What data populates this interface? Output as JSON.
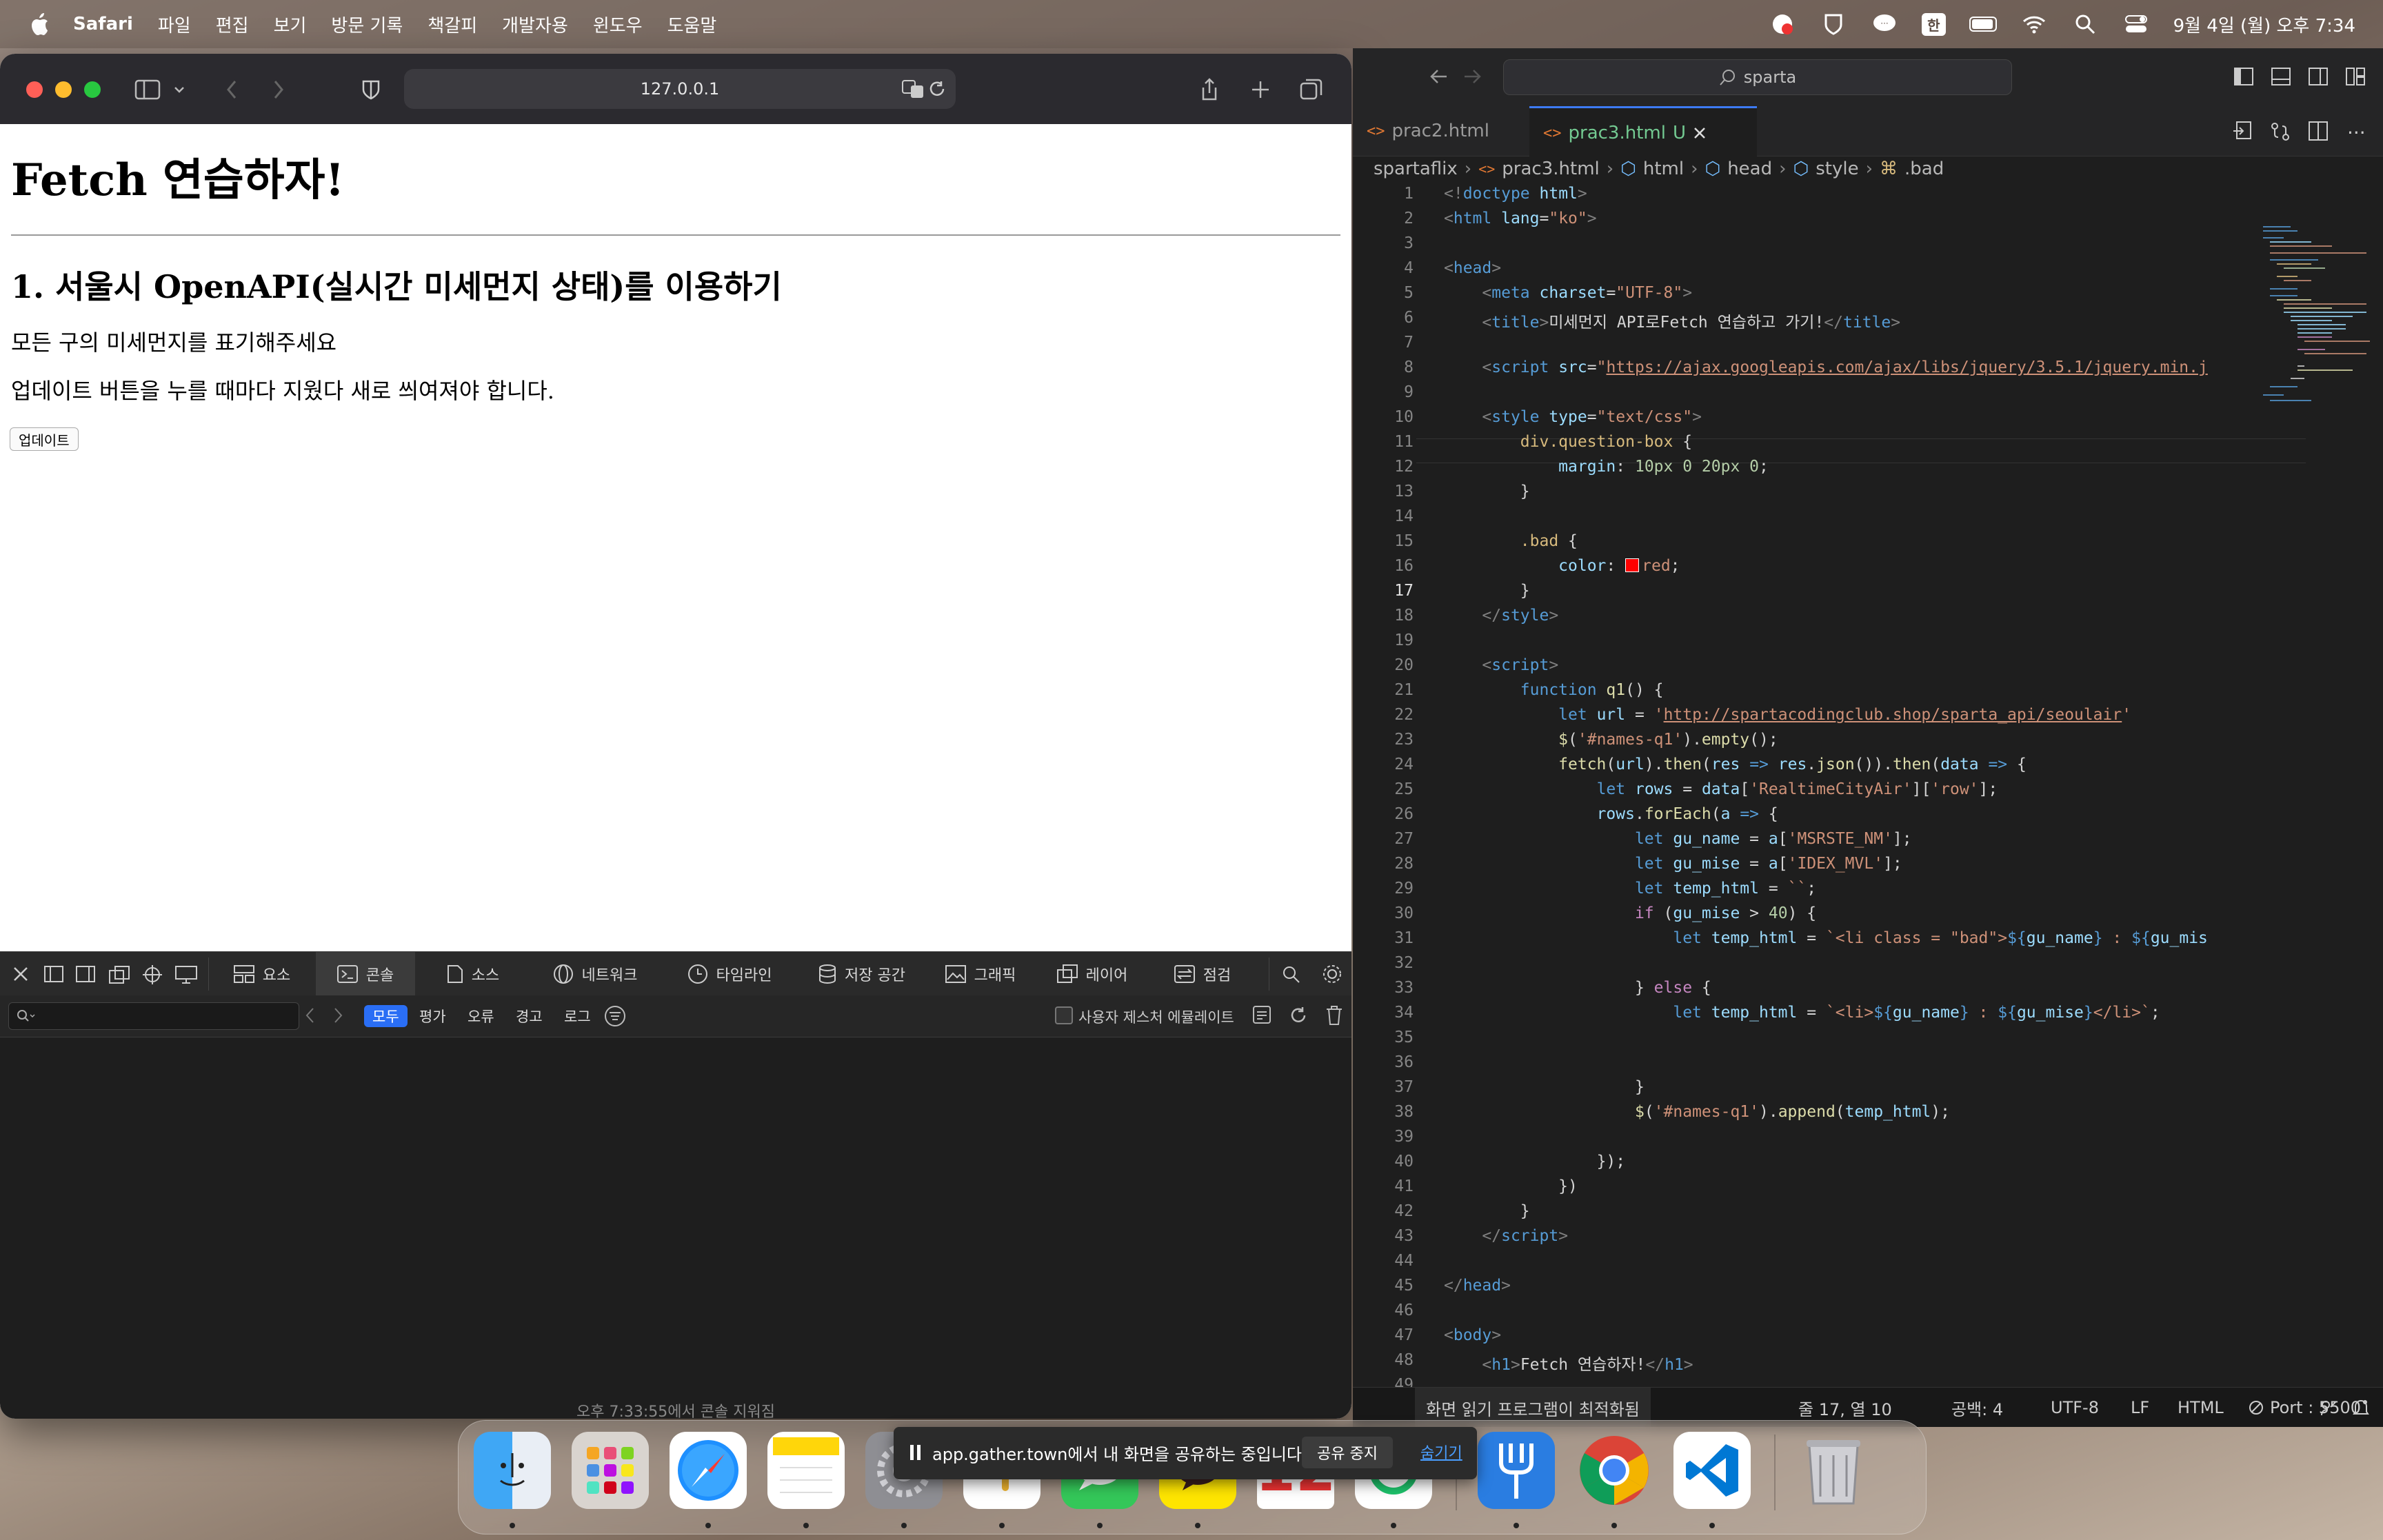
{
  "menubar": {
    "app_name": "Safari",
    "items": [
      "파일",
      "편집",
      "보기",
      "방문 기록",
      "책갈피",
      "개발자용",
      "윈도우",
      "도움말"
    ],
    "status_input": "한",
    "clock": "9월 4일 (월) 오후 7:34"
  },
  "safari": {
    "address": "127.0.0.1",
    "page": {
      "h1": "Fetch 연습하자!",
      "h2": "1. 서울시 OpenAPI(실시간 미세먼지 상태)를 이용하기",
      "p1": "모든 구의 미세먼지를 표기해주세요",
      "p2": "업데이트 버튼을 누를 때마다 지웠다 새로 씌여져야 합니다.",
      "button": "업데이트"
    }
  },
  "devtools": {
    "tabs": [
      "요소",
      "콘솔",
      "소스",
      "네트워크",
      "타임라인",
      "저장 공간",
      "그래픽",
      "레이어",
      "점검"
    ],
    "active_tab": "콘솔",
    "levels": [
      "모두",
      "평가",
      "오류",
      "경고",
      "로그"
    ],
    "active_level": "모두",
    "user_gesture_label": "사용자 제스처 에뮬레이트",
    "cleared_message": "오후 7:33:55에서 콘솔 지워짐"
  },
  "vscode": {
    "search": "sparta",
    "tabs": [
      {
        "label": "prac2.html",
        "active": false
      },
      {
        "label": "prac3.html",
        "active": true,
        "badge": "U"
      }
    ],
    "breadcrumb": [
      "spartaflix",
      "prac3.html",
      "html",
      "head",
      "style",
      ".bad"
    ],
    "current_line": 17,
    "lines": [
      "1",
      "2",
      "3",
      "4",
      "5",
      "6",
      "7",
      "8",
      "9",
      "10",
      "11",
      "12",
      "13",
      "14",
      "15",
      "16",
      "17",
      "18",
      "19",
      "20",
      "21",
      "22",
      "23",
      "24",
      "25",
      "26",
      "27",
      "28",
      "29",
      "30",
      "31",
      "32",
      "33",
      "34",
      "35",
      "36",
      "37",
      "38",
      "39",
      "40",
      "41",
      "42",
      "43",
      "44",
      "45",
      "46",
      "47",
      "48",
      "49"
    ],
    "status": {
      "screen_reader": "화면 읽기 프로그램이 최적화됨",
      "position": "줄 17, 열 10",
      "spaces": "공백: 4",
      "encoding": "UTF-8",
      "eol": "LF",
      "language": "HTML",
      "port": "Port : 5500"
    }
  },
  "sharebar": {
    "message": "app.gather.town에서 내 화면을 공유하는 중입니다.",
    "stop": "공유 중지",
    "hide": "숨기기"
  },
  "dock": {
    "apps": [
      "finder",
      "launchpad",
      "safari",
      "notes",
      "system-settings",
      "slack",
      "messages",
      "kakaotalk",
      "calendar",
      "lms",
      "fork",
      "chrome",
      "vscode",
      "trash"
    ]
  }
}
